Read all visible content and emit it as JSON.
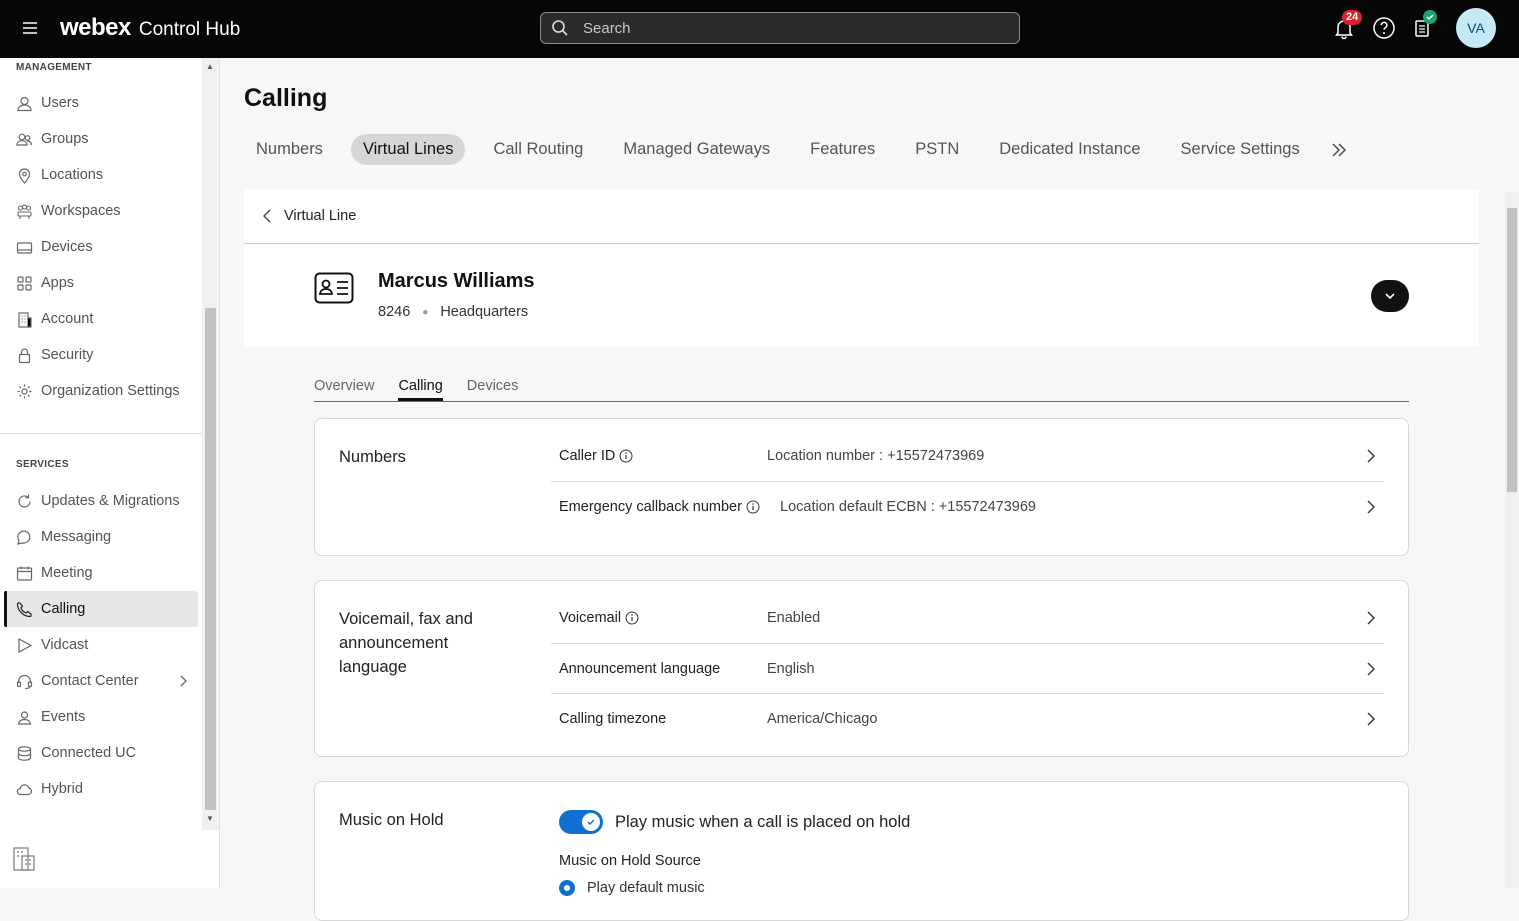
{
  "topbar": {
    "brand_logo": "webex",
    "brand_product": "Control Hub",
    "search_placeholder": "Search",
    "notification_count": "24",
    "avatar_initials": "VA"
  },
  "sidebar": {
    "management_label": "MANAGEMENT",
    "management_items": [
      {
        "label": "Users",
        "icon": "user-icon"
      },
      {
        "label": "Groups",
        "icon": "groups-icon"
      },
      {
        "label": "Locations",
        "icon": "location-pin-icon"
      },
      {
        "label": "Workspaces",
        "icon": "workspaces-icon"
      },
      {
        "label": "Devices",
        "icon": "devices-icon"
      },
      {
        "label": "Apps",
        "icon": "apps-grid-icon"
      },
      {
        "label": "Account",
        "icon": "building-icon"
      },
      {
        "label": "Security",
        "icon": "lock-icon"
      },
      {
        "label": "Organization Settings",
        "icon": "gear-icon"
      }
    ],
    "services_label": "SERVICES",
    "services_items": [
      {
        "label": "Updates & Migrations",
        "icon": "refresh-icon"
      },
      {
        "label": "Messaging",
        "icon": "chat-bubble-icon"
      },
      {
        "label": "Meeting",
        "icon": "calendar-icon"
      },
      {
        "label": "Calling",
        "icon": "phone-icon",
        "active": true
      },
      {
        "label": "Vidcast",
        "icon": "play-icon"
      },
      {
        "label": "Contact Center",
        "icon": "headset-icon",
        "has_submenu": true
      },
      {
        "label": "Events",
        "icon": "events-icon"
      },
      {
        "label": "Connected UC",
        "icon": "stack-icon"
      },
      {
        "label": "Hybrid",
        "icon": "cloud-icon"
      }
    ]
  },
  "main": {
    "page_title": "Calling",
    "tabs": [
      {
        "label": "Numbers"
      },
      {
        "label": "Virtual Lines",
        "active": true
      },
      {
        "label": "Call Routing"
      },
      {
        "label": "Managed Gateways"
      },
      {
        "label": "Features"
      },
      {
        "label": "PSTN"
      },
      {
        "label": "Dedicated Instance"
      },
      {
        "label": "Service Settings"
      }
    ],
    "breadcrumb": "Virtual Line",
    "person": {
      "name": "Marcus Williams",
      "extension": "8246",
      "location": "Headquarters"
    },
    "subtabs": [
      {
        "label": "Overview"
      },
      {
        "label": "Calling",
        "active": true
      },
      {
        "label": "Devices"
      }
    ],
    "numbers_card": {
      "title": "Numbers",
      "rows": [
        {
          "label": "Caller ID",
          "info": true,
          "value": "Location number : +15572473969"
        },
        {
          "label": "Emergency callback number",
          "info": true,
          "value": "Location default ECBN : +15572473969"
        }
      ]
    },
    "voicemail_card": {
      "title": "Voicemail, fax and announcement language",
      "rows": [
        {
          "label": "Voicemail",
          "info": true,
          "value": "Enabled"
        },
        {
          "label": "Announcement language",
          "info": false,
          "value": "English"
        },
        {
          "label": "Calling timezone",
          "info": false,
          "value": "America/Chicago"
        }
      ]
    },
    "moh_card": {
      "title": "Music on Hold",
      "toggle_label": "Play music when a call is placed on hold",
      "toggle_on": true,
      "source_label": "Music on Hold Source",
      "option_label": "Play default music"
    }
  },
  "colors": {
    "topbar_bg": "#070707",
    "accent_blue": "#1170cf",
    "notification_red": "#d9232e",
    "status_green": "#1aa56f"
  }
}
